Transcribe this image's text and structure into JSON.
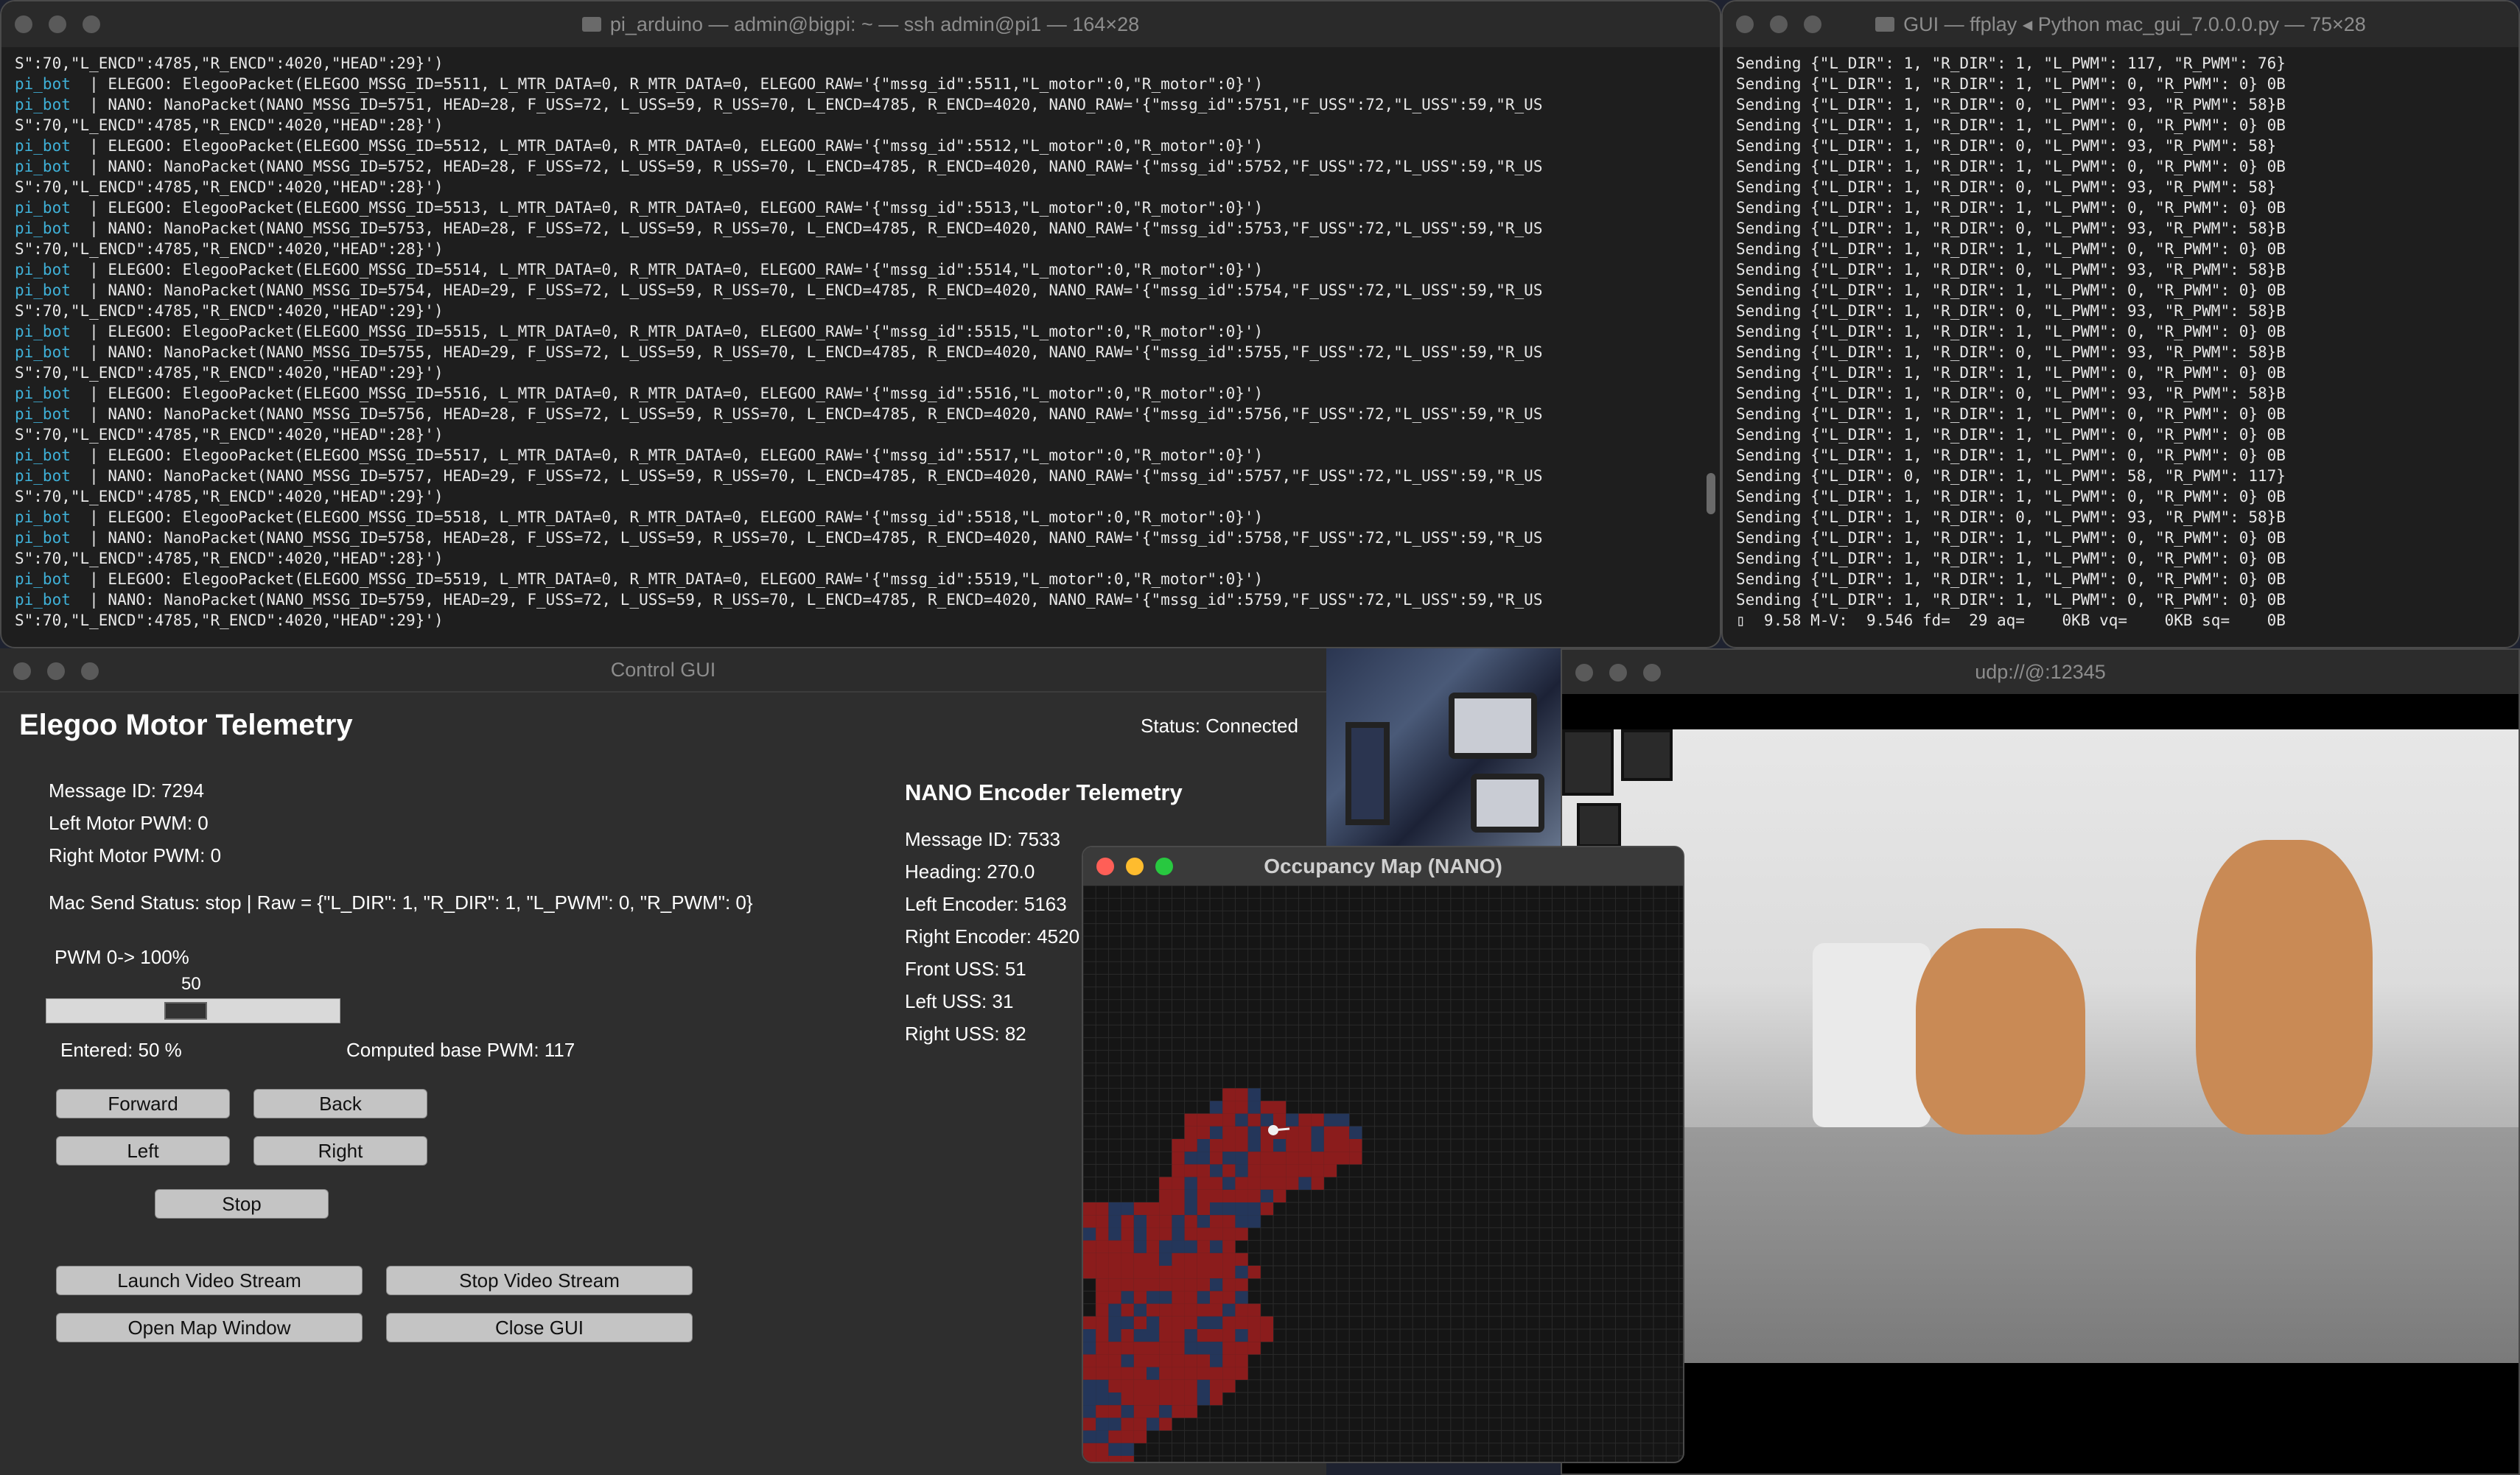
{
  "term1": {
    "title": "pi_arduino — admin@bigpi: ~ — ssh admin@pi1 — 164×28",
    "lines": [
      {
        "p": "",
        "t": "S\":70,\"L_ENCD\":4785,\"R_ENCD\":4020,\"HEAD\":29}')"
      },
      {
        "p": "pi_bot",
        "t": "  | ELEGOO: ElegooPacket(ELEGOO_MSSG_ID=5511, L_MTR_DATA=0, R_MTR_DATA=0, ELEGOO_RAW='{\"mssg_id\":5511,\"L_motor\":0,\"R_motor\":0}')"
      },
      {
        "p": "pi_bot",
        "t": "  | NANO: NanoPacket(NANO_MSSG_ID=5751, HEAD=28, F_USS=72, L_USS=59, R_USS=70, L_ENCD=4785, R_ENCD=4020, NANO_RAW='{\"mssg_id\":5751,\"F_USS\":72,\"L_USS\":59,\"R_US"
      },
      {
        "p": "",
        "t": "S\":70,\"L_ENCD\":4785,\"R_ENCD\":4020,\"HEAD\":28}')"
      },
      {
        "p": "pi_bot",
        "t": "  | ELEGOO: ElegooPacket(ELEGOO_MSSG_ID=5512, L_MTR_DATA=0, R_MTR_DATA=0, ELEGOO_RAW='{\"mssg_id\":5512,\"L_motor\":0,\"R_motor\":0}')"
      },
      {
        "p": "pi_bot",
        "t": "  | NANO: NanoPacket(NANO_MSSG_ID=5752, HEAD=28, F_USS=72, L_USS=59, R_USS=70, L_ENCD=4785, R_ENCD=4020, NANO_RAW='{\"mssg_id\":5752,\"F_USS\":72,\"L_USS\":59,\"R_US"
      },
      {
        "p": "",
        "t": "S\":70,\"L_ENCD\":4785,\"R_ENCD\":4020,\"HEAD\":28}')"
      },
      {
        "p": "pi_bot",
        "t": "  | ELEGOO: ElegooPacket(ELEGOO_MSSG_ID=5513, L_MTR_DATA=0, R_MTR_DATA=0, ELEGOO_RAW='{\"mssg_id\":5513,\"L_motor\":0,\"R_motor\":0}')"
      },
      {
        "p": "pi_bot",
        "t": "  | NANO: NanoPacket(NANO_MSSG_ID=5753, HEAD=28, F_USS=72, L_USS=59, R_USS=70, L_ENCD=4785, R_ENCD=4020, NANO_RAW='{\"mssg_id\":5753,\"F_USS\":72,\"L_USS\":59,\"R_US"
      },
      {
        "p": "",
        "t": "S\":70,\"L_ENCD\":4785,\"R_ENCD\":4020,\"HEAD\":28}')"
      },
      {
        "p": "pi_bot",
        "t": "  | ELEGOO: ElegooPacket(ELEGOO_MSSG_ID=5514, L_MTR_DATA=0, R_MTR_DATA=0, ELEGOO_RAW='{\"mssg_id\":5514,\"L_motor\":0,\"R_motor\":0}')"
      },
      {
        "p": "pi_bot",
        "t": "  | NANO: NanoPacket(NANO_MSSG_ID=5754, HEAD=29, F_USS=72, L_USS=59, R_USS=70, L_ENCD=4785, R_ENCD=4020, NANO_RAW='{\"mssg_id\":5754,\"F_USS\":72,\"L_USS\":59,\"R_US"
      },
      {
        "p": "",
        "t": "S\":70,\"L_ENCD\":4785,\"R_ENCD\":4020,\"HEAD\":29}')"
      },
      {
        "p": "pi_bot",
        "t": "  | ELEGOO: ElegooPacket(ELEGOO_MSSG_ID=5515, L_MTR_DATA=0, R_MTR_DATA=0, ELEGOO_RAW='{\"mssg_id\":5515,\"L_motor\":0,\"R_motor\":0}')"
      },
      {
        "p": "pi_bot",
        "t": "  | NANO: NanoPacket(NANO_MSSG_ID=5755, HEAD=29, F_USS=72, L_USS=59, R_USS=70, L_ENCD=4785, R_ENCD=4020, NANO_RAW='{\"mssg_id\":5755,\"F_USS\":72,\"L_USS\":59,\"R_US"
      },
      {
        "p": "",
        "t": "S\":70,\"L_ENCD\":4785,\"R_ENCD\":4020,\"HEAD\":29}')"
      },
      {
        "p": "pi_bot",
        "t": "  | ELEGOO: ElegooPacket(ELEGOO_MSSG_ID=5516, L_MTR_DATA=0, R_MTR_DATA=0, ELEGOO_RAW='{\"mssg_id\":5516,\"L_motor\":0,\"R_motor\":0}')"
      },
      {
        "p": "pi_bot",
        "t": "  | NANO: NanoPacket(NANO_MSSG_ID=5756, HEAD=28, F_USS=72, L_USS=59, R_USS=70, L_ENCD=4785, R_ENCD=4020, NANO_RAW='{\"mssg_id\":5756,\"F_USS\":72,\"L_USS\":59,\"R_US"
      },
      {
        "p": "",
        "t": "S\":70,\"L_ENCD\":4785,\"R_ENCD\":4020,\"HEAD\":28}')"
      },
      {
        "p": "pi_bot",
        "t": "  | ELEGOO: ElegooPacket(ELEGOO_MSSG_ID=5517, L_MTR_DATA=0, R_MTR_DATA=0, ELEGOO_RAW='{\"mssg_id\":5517,\"L_motor\":0,\"R_motor\":0}')"
      },
      {
        "p": "pi_bot",
        "t": "  | NANO: NanoPacket(NANO_MSSG_ID=5757, HEAD=29, F_USS=72, L_USS=59, R_USS=70, L_ENCD=4785, R_ENCD=4020, NANO_RAW='{\"mssg_id\":5757,\"F_USS\":72,\"L_USS\":59,\"R_US"
      },
      {
        "p": "",
        "t": "S\":70,\"L_ENCD\":4785,\"R_ENCD\":4020,\"HEAD\":29}')"
      },
      {
        "p": "pi_bot",
        "t": "  | ELEGOO: ElegooPacket(ELEGOO_MSSG_ID=5518, L_MTR_DATA=0, R_MTR_DATA=0, ELEGOO_RAW='{\"mssg_id\":5518,\"L_motor\":0,\"R_motor\":0}')"
      },
      {
        "p": "pi_bot",
        "t": "  | NANO: NanoPacket(NANO_MSSG_ID=5758, HEAD=28, F_USS=72, L_USS=59, R_USS=70, L_ENCD=4785, R_ENCD=4020, NANO_RAW='{\"mssg_id\":5758,\"F_USS\":72,\"L_USS\":59,\"R_US"
      },
      {
        "p": "",
        "t": "S\":70,\"L_ENCD\":4785,\"R_ENCD\":4020,\"HEAD\":28}')"
      },
      {
        "p": "pi_bot",
        "t": "  | ELEGOO: ElegooPacket(ELEGOO_MSSG_ID=5519, L_MTR_DATA=0, R_MTR_DATA=0, ELEGOO_RAW='{\"mssg_id\":5519,\"L_motor\":0,\"R_motor\":0}')"
      },
      {
        "p": "pi_bot",
        "t": "  | NANO: NanoPacket(NANO_MSSG_ID=5759, HEAD=29, F_USS=72, L_USS=59, R_USS=70, L_ENCD=4785, R_ENCD=4020, NANO_RAW='{\"mssg_id\":5759,\"F_USS\":72,\"L_USS\":59,\"R_US"
      },
      {
        "p": "",
        "t": "S\":70,\"L_ENCD\":4785,\"R_ENCD\":4020,\"HEAD\":29}')"
      }
    ]
  },
  "term2": {
    "title": "GUI — ffplay ◂ Python mac_gui_7.0.0.0.py — 75×28",
    "lines": [
      "Sending {\"L_DIR\": 1, \"R_DIR\": 1, \"L_PWM\": 117, \"R_PWM\": 76}",
      "Sending {\"L_DIR\": 1, \"R_DIR\": 1, \"L_PWM\": 0, \"R_PWM\": 0} 0B",
      "Sending {\"L_DIR\": 1, \"R_DIR\": 0, \"L_PWM\": 93, \"R_PWM\": 58}B",
      "Sending {\"L_DIR\": 1, \"R_DIR\": 1, \"L_PWM\": 0, \"R_PWM\": 0} 0B",
      "Sending {\"L_DIR\": 1, \"R_DIR\": 0, \"L_PWM\": 93, \"R_PWM\": 58}",
      "Sending {\"L_DIR\": 1, \"R_DIR\": 1, \"L_PWM\": 0, \"R_PWM\": 0} 0B",
      "Sending {\"L_DIR\": 1, \"R_DIR\": 0, \"L_PWM\": 93, \"R_PWM\": 58}",
      "Sending {\"L_DIR\": 1, \"R_DIR\": 1, \"L_PWM\": 0, \"R_PWM\": 0} 0B",
      "Sending {\"L_DIR\": 1, \"R_DIR\": 0, \"L_PWM\": 93, \"R_PWM\": 58}B",
      "Sending {\"L_DIR\": 1, \"R_DIR\": 1, \"L_PWM\": 0, \"R_PWM\": 0} 0B",
      "Sending {\"L_DIR\": 1, \"R_DIR\": 0, \"L_PWM\": 93, \"R_PWM\": 58}B",
      "Sending {\"L_DIR\": 1, \"R_DIR\": 1, \"L_PWM\": 0, \"R_PWM\": 0} 0B",
      "Sending {\"L_DIR\": 1, \"R_DIR\": 0, \"L_PWM\": 93, \"R_PWM\": 58}B",
      "Sending {\"L_DIR\": 1, \"R_DIR\": 1, \"L_PWM\": 0, \"R_PWM\": 0} 0B",
      "Sending {\"L_DIR\": 1, \"R_DIR\": 0, \"L_PWM\": 93, \"R_PWM\": 58}B",
      "Sending {\"L_DIR\": 1, \"R_DIR\": 1, \"L_PWM\": 0, \"R_PWM\": 0} 0B",
      "Sending {\"L_DIR\": 1, \"R_DIR\": 0, \"L_PWM\": 93, \"R_PWM\": 58}B",
      "Sending {\"L_DIR\": 1, \"R_DIR\": 1, \"L_PWM\": 0, \"R_PWM\": 0} 0B",
      "Sending {\"L_DIR\": 1, \"R_DIR\": 1, \"L_PWM\": 0, \"R_PWM\": 0} 0B",
      "Sending {\"L_DIR\": 1, \"R_DIR\": 1, \"L_PWM\": 0, \"R_PWM\": 0} 0B",
      "Sending {\"L_DIR\": 0, \"R_DIR\": 1, \"L_PWM\": 58, \"R_PWM\": 117}",
      "Sending {\"L_DIR\": 1, \"R_DIR\": 1, \"L_PWM\": 0, \"R_PWM\": 0} 0B",
      "Sending {\"L_DIR\": 1, \"R_DIR\": 0, \"L_PWM\": 93, \"R_PWM\": 58}B",
      "Sending {\"L_DIR\": 1, \"R_DIR\": 1, \"L_PWM\": 0, \"R_PWM\": 0} 0B",
      "Sending {\"L_DIR\": 1, \"R_DIR\": 1, \"L_PWM\": 0, \"R_PWM\": 0} 0B",
      "Sending {\"L_DIR\": 1, \"R_DIR\": 1, \"L_PWM\": 0, \"R_PWM\": 0} 0B",
      "Sending {\"L_DIR\": 1, \"R_DIR\": 1, \"L_PWM\": 0, \"R_PWM\": 0} 0B",
      "▯  9.58 M-V:  9.546 fd=  29 aq=    0KB vq=    0KB sq=    0B"
    ]
  },
  "gui": {
    "title": "Control GUI",
    "heading": "Elegoo Motor Telemetry",
    "status": "Status: Connected",
    "message_id": "Message ID: 7294",
    "left_pwm": "Left Motor PWM: 0",
    "right_pwm": "Right Motor PWM: 0",
    "mac_send": "Mac Send Status: stop | Raw = {\"L_DIR\": 1, \"R_DIR\": 1, \"L_PWM\": 0, \"R_PWM\": 0}",
    "slider_label": "PWM 0-> 100%",
    "slider_value": "50",
    "slider_fraction": 0.5,
    "entered": "Entered: 50 %",
    "computed": "Computed base PWM: 117",
    "buttons": {
      "forward": "Forward",
      "back": "Back",
      "left": "Left",
      "right": "Right",
      "stop": "Stop",
      "launch_video": "Launch Video Stream",
      "stop_video": "Stop Video Stream",
      "open_map": "Open Map Window",
      "close_gui": "Close GUI"
    },
    "nano": {
      "heading": "NANO Encoder Telemetry",
      "message_id": "Message ID: 7533",
      "heading_val": "Heading: 270.0",
      "left_encoder": "Left Encoder: 5163",
      "right_encoder": "Right Encoder: 4520",
      "front_uss": "Front USS: 51",
      "left_uss": "Left USS: 31",
      "right_uss": "Right USS: 82"
    }
  },
  "map": {
    "title": "Occupancy Map (NANO)",
    "colors": {
      "occupied": "#8b1c1c",
      "free": "#24365a",
      "unknown": "#1a1a1a",
      "grid": "#2a2a2a"
    },
    "robot_color": "#f0f0f0"
  },
  "video": {
    "title": "udp://@:12345"
  }
}
